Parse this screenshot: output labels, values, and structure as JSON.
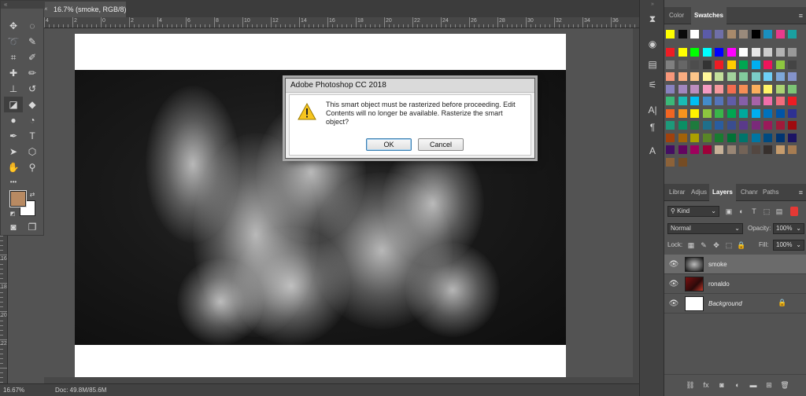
{
  "document": {
    "tab_title": "16.7% (smoke, RGB/8) *",
    "close_glyph": "×"
  },
  "rulers": {
    "h_labels": [
      "4",
      "2",
      "0",
      "2",
      "4",
      "6",
      "8",
      "10",
      "12",
      "14",
      "16",
      "18",
      "20",
      "22",
      "24",
      "26",
      "28",
      "30",
      "32",
      "34",
      "36"
    ],
    "v_labels": [
      "0",
      "2",
      "4",
      "6",
      "8",
      "10",
      "12",
      "14",
      "16",
      "18",
      "20",
      "22"
    ]
  },
  "status_bar": {
    "zoom": "16.67%",
    "doc_info": "Doc: 49.8M/85.6M"
  },
  "dialog": {
    "title": "Adobe Photoshop CC 2018",
    "message": "This smart object must be rasterized before proceeding.  Edit Contents will no longer be available.  Rasterize the smart object?",
    "ok_label": "OK",
    "cancel_label": "Cancel"
  },
  "toolbar": {
    "grip": "«",
    "tools": [
      {
        "name": "move-tool-icon",
        "glyph": "✥"
      },
      {
        "name": "marquee-tool-icon",
        "glyph": "◌"
      },
      {
        "name": "lasso-tool-icon",
        "glyph": "➰"
      },
      {
        "name": "quick-select-tool-icon",
        "glyph": "✎"
      },
      {
        "name": "crop-tool-icon",
        "glyph": "⌗"
      },
      {
        "name": "eyedropper-tool-icon",
        "glyph": "✐"
      },
      {
        "name": "healing-brush-tool-icon",
        "glyph": "✚"
      },
      {
        "name": "brush-tool-icon",
        "glyph": "✏"
      },
      {
        "name": "clone-stamp-tool-icon",
        "glyph": "⊥"
      },
      {
        "name": "history-brush-tool-icon",
        "glyph": "↺"
      },
      {
        "name": "eraser-tool-icon",
        "glyph": "◪"
      },
      {
        "name": "paint-bucket-tool-icon",
        "glyph": "◆"
      },
      {
        "name": "blur-tool-icon",
        "glyph": "●"
      },
      {
        "name": "dodge-tool-icon",
        "glyph": "◔"
      },
      {
        "name": "pen-tool-icon",
        "glyph": "✒"
      },
      {
        "name": "type-tool-icon",
        "glyph": "T"
      },
      {
        "name": "path-select-tool-icon",
        "glyph": "➤"
      },
      {
        "name": "shape-tool-icon",
        "glyph": "⬡"
      },
      {
        "name": "hand-tool-icon",
        "glyph": "✋"
      },
      {
        "name": "zoom-tool-icon",
        "glyph": "⚲"
      },
      {
        "name": "more-tools-icon",
        "glyph": "•••"
      },
      {
        "name": "quick-mask-icon",
        "glyph": "◙"
      },
      {
        "name": "screen-mode-icon",
        "glyph": "❐"
      }
    ],
    "colors": {
      "foreground": "#b88a62",
      "background": "#ffffff"
    }
  },
  "dock": {
    "icons": [
      {
        "name": "history-panel-icon",
        "glyph": "⧗"
      },
      {
        "name": "properties-panel-icon",
        "glyph": "◉"
      },
      {
        "name": "channels-mini-icon",
        "glyph": "▤"
      },
      {
        "name": "adjustments-mini-icon",
        "glyph": "⚟"
      },
      {
        "name": "character-panel-icon",
        "glyph": "A|"
      },
      {
        "name": "paragraph-panel-icon",
        "glyph": "¶"
      },
      {
        "name": "glyphs-panel-icon",
        "glyph": "A"
      }
    ]
  },
  "swatches_panel": {
    "tabs": [
      "Color",
      "Swatches"
    ],
    "active_tab": "Swatches",
    "menu": "≡",
    "rows": [
      [
        "#ffff00",
        "#0b0b0b",
        "#ffffff",
        "#5b5ba8",
        "#6f6fa8",
        "#a88a6b",
        "#9a8a7b",
        "#000000",
        "#1a8fbf",
        "#e83a8c",
        "#1aa0a0"
      ],
      [
        "#ee1c24",
        "#ffff00",
        "#00ff00",
        "#00ffff",
        "#0000ff",
        "#ff00ff",
        "#ffffff",
        "#e6e6e6",
        "#cccccc",
        "#b3b3b3",
        "#999999"
      ],
      [
        "#808080",
        "#666666",
        "#4d4d4d",
        "#333333",
        "#ed1c24",
        "#ffcc00",
        "#00a651",
        "#00aeef",
        "#ed145b",
        "#8dc63f",
        "#444444"
      ],
      [
        "#f7977a",
        "#f9ad81",
        "#fdc68a",
        "#fff79a",
        "#c4df9b",
        "#a2d39c",
        "#82ca9d",
        "#7bcdc8",
        "#6ecff6",
        "#7ea7d8",
        "#8493ca"
      ],
      [
        "#8882be",
        "#a187be",
        "#bc8dbf",
        "#f49ac2",
        "#f6989d",
        "#f26c4f",
        "#f68e55",
        "#fbaf5c",
        "#fff467",
        "#acd372",
        "#7cc576"
      ],
      [
        "#3bb878",
        "#1abbb4",
        "#00bff3",
        "#438ccb",
        "#5574b9",
        "#605ca8",
        "#855fa8",
        "#a763a8",
        "#f06eaa",
        "#f26d7d",
        "#ed1c24"
      ],
      [
        "#f26522",
        "#f7941d",
        "#fff200",
        "#8dc63f",
        "#39b54a",
        "#00a651",
        "#00a99d",
        "#00aeef",
        "#0072bc",
        "#0054a6",
        "#2e3192"
      ],
      [
        "#1d9a7a",
        "#0b8f64",
        "#1e7a3d",
        "#1f6f8a",
        "#2a5d9f",
        "#3a4d8f",
        "#5a3a8a",
        "#7a2a7a",
        "#9a1a5a",
        "#a01a3a",
        "#9e0b0f"
      ],
      [
        "#a0410d",
        "#a36209",
        "#aba000",
        "#598527",
        "#197b30",
        "#007236",
        "#00746b",
        "#0076a3",
        "#004a80",
        "#003471",
        "#1b1464"
      ],
      [
        "#440e62",
        "#630460",
        "#9e005d",
        "#9e0039",
        "#c7b299",
        "#998675",
        "#736357",
        "#534741",
        "#37302d",
        "#c69c6d",
        "#a67c52"
      ],
      [
        "#8c6239",
        "#754c24"
      ]
    ]
  },
  "layers_panel": {
    "tabs": [
      "Librar",
      "Adjus",
      "Layers",
      "Chanr",
      "Paths"
    ],
    "active_tab": "Layers",
    "menu": "≡",
    "filter_label": "Kind",
    "blend_mode": "Normal",
    "opacity_label": "Opacity:",
    "opacity_value": "100%",
    "lock_label": "Lock:",
    "fill_label": "Fill:",
    "fill_value": "100%",
    "layers": [
      {
        "name": "smoke",
        "selected": true,
        "italic": false,
        "locked": false
      },
      {
        "name": "ronaldo",
        "selected": false,
        "italic": false,
        "locked": false
      },
      {
        "name": "Background",
        "selected": false,
        "italic": true,
        "locked": true
      }
    ]
  }
}
